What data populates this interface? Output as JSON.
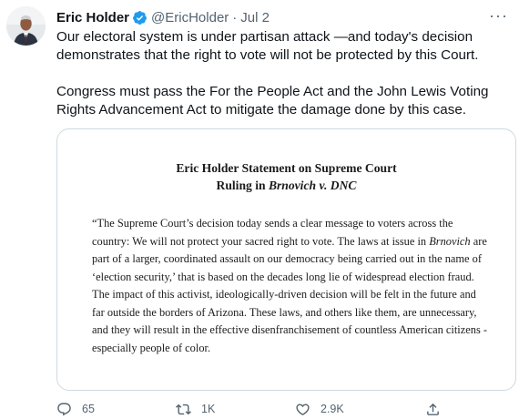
{
  "tweet": {
    "author": {
      "display_name": "Eric Holder",
      "handle": "@EricHolder",
      "verified": true
    },
    "separator": "·",
    "date": "Jul 2",
    "more_icon": "more-horizontal-icon",
    "text": {
      "paragraph_1": "Our electoral system is under partisan attack —and today's decision demonstrates that the right to vote will not be protected by this Court.",
      "paragraph_2": "Congress must pass the For the People Act and the John Lewis Voting Rights Advancement Act to mitigate the damage done by this case."
    }
  },
  "card": {
    "title_line_1": "Eric Holder Statement on Supreme Court",
    "title_line_2_prefix": "Ruling in ",
    "title_line_2_italic": "Brnovich v. DNC",
    "body_part_1": "“The Supreme Court’s decision today sends a clear message to voters across the country: We will not protect your sacred right to vote. The laws at issue in ",
    "body_italic": "Brnovich",
    "body_part_2": " are part of a larger, coordinated assault on our democracy being carried out in the name of ‘election security,’ that is based on the decades long lie of widespread election fraud. The impact of this activist, ideologically-driven decision will be felt in the future and far outside the borders of Arizona. These laws, and others like them, are unnecessary, and they will result in the effective disenfranchisement of countless American citizens - especially people of color."
  },
  "actions": {
    "reply": {
      "icon": "reply-icon",
      "count": "65"
    },
    "retweet": {
      "icon": "retweet-icon",
      "count": "1K"
    },
    "like": {
      "icon": "heart-icon",
      "count": "2.9K"
    },
    "share": {
      "icon": "share-icon"
    }
  },
  "colors": {
    "text_primary": "#0f1419",
    "text_secondary": "#536471",
    "verified_badge": "#1d9bf0",
    "card_border": "#cfd9de"
  }
}
